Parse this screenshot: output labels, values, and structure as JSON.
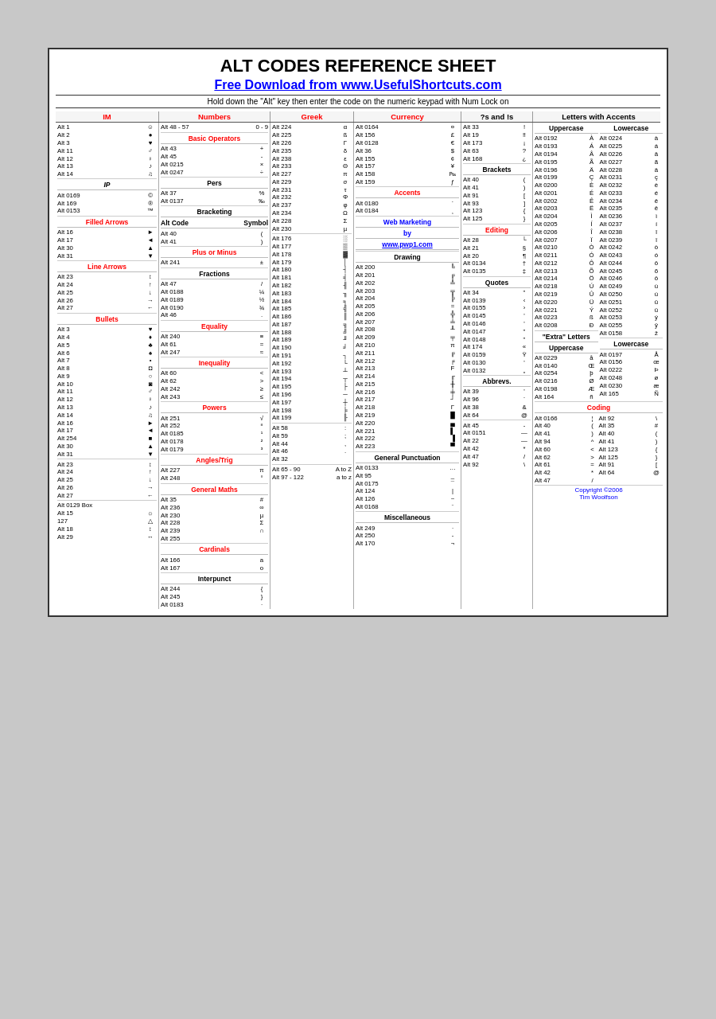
{
  "title": "ALT CODES REFERENCE SHEET",
  "subtitle": "Free Download from www.UsefulShortcuts.com",
  "instruction": "Hold down the \"Alt\" key then enter the code on the numeric keypad with Num Lock on",
  "copyright": "Copyright ©2006",
  "author": "Tim Woolfson",
  "columns": {
    "col1_header": "IM",
    "col2_header": "Numbers",
    "col3_header": "Greek",
    "col4_header": "Currency",
    "col5_header": "?s and !s",
    "col6_header": "Letters with Accents"
  }
}
